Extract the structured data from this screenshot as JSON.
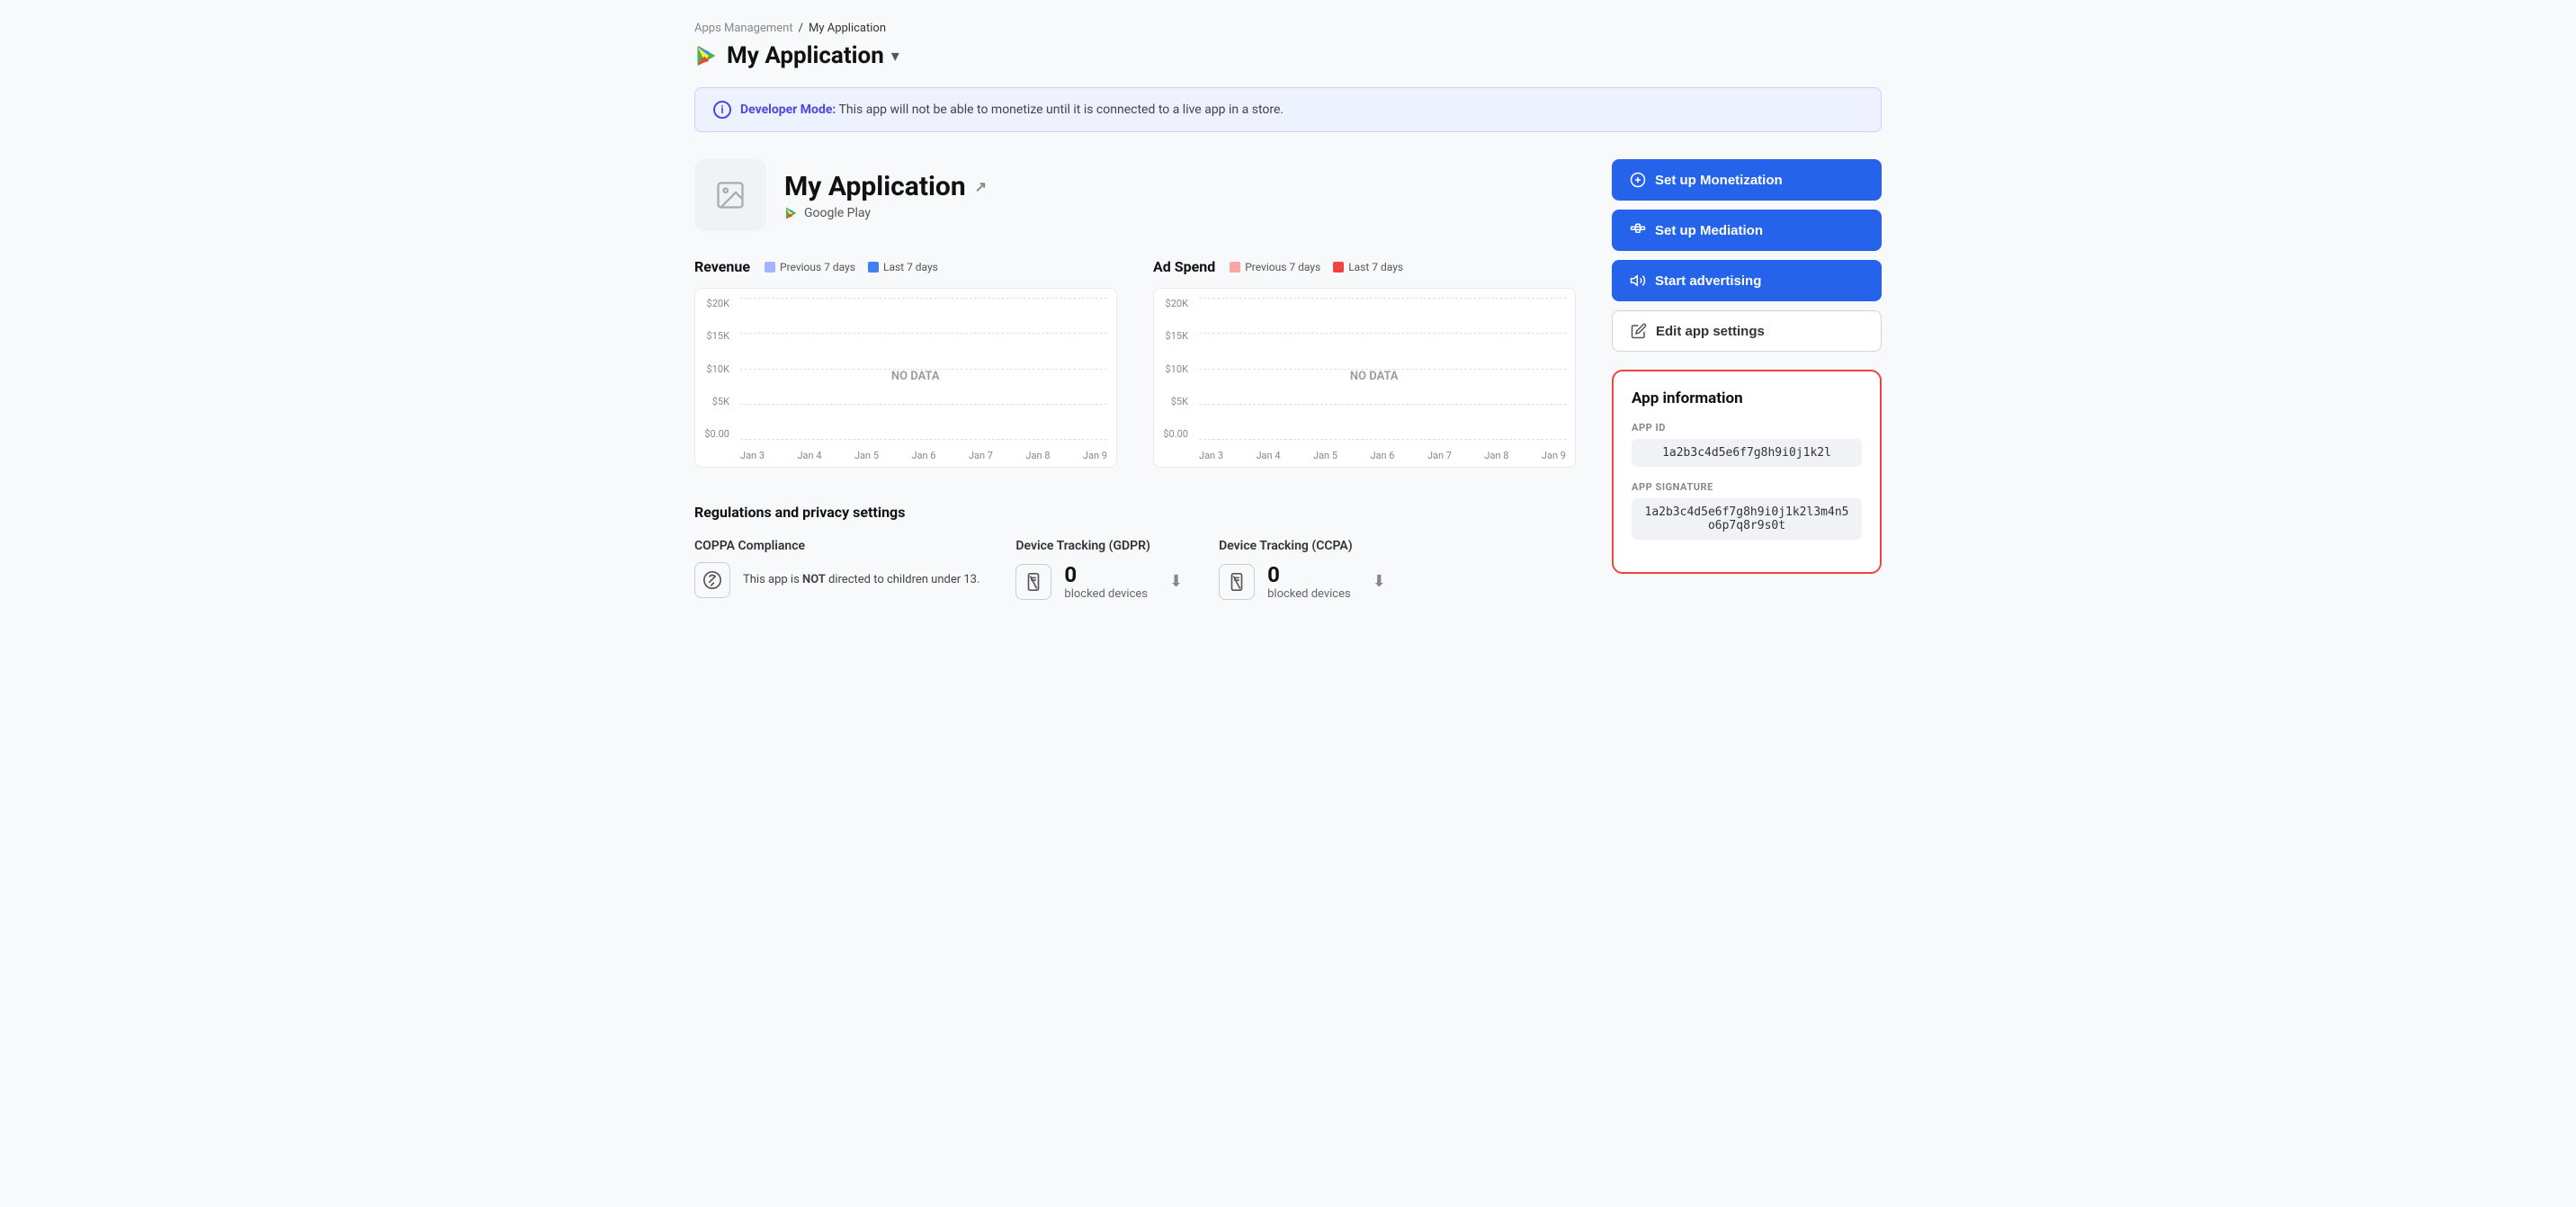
{
  "breadcrumb": {
    "parent": "Apps Management",
    "separator": "/",
    "current": "My Application"
  },
  "header": {
    "app_name": "My Application",
    "chevron": "▾"
  },
  "banner": {
    "label": "Developer Mode:",
    "message": "This app will not be able to monetize until it is connected to a live app in a store."
  },
  "app_card": {
    "title": "My Application",
    "platform": "Google Play",
    "external_link": "↗"
  },
  "charts": {
    "revenue": {
      "title": "Revenue",
      "legend_prev": "Previous 7 days",
      "legend_last": "Last 7 days",
      "prev_color": "#a5b4fc",
      "last_color": "#3b82f6",
      "y_labels": [
        "$20K",
        "$15K",
        "$10K",
        "$5K",
        "$0.00"
      ],
      "x_labels": [
        "Jan 3",
        "Jan 4",
        "Jan 5",
        "Jan 6",
        "Jan 7",
        "Jan 8",
        "Jan 9"
      ],
      "no_data": "NO DATA"
    },
    "ad_spend": {
      "title": "Ad Spend",
      "legend_prev": "Previous 7 days",
      "legend_last": "Last 7 days",
      "prev_color": "#fca5a5",
      "last_color": "#ef4444",
      "y_labels": [
        "$20K",
        "$15K",
        "$10K",
        "$5K",
        "$0.00"
      ],
      "x_labels": [
        "Jan 3",
        "Jan 4",
        "Jan 5",
        "Jan 6",
        "Jan 7",
        "Jan 8",
        "Jan 9"
      ],
      "no_data": "NO DATA"
    }
  },
  "regulations": {
    "section_title": "Regulations and privacy settings",
    "coppa": {
      "title": "COPPA Compliance",
      "description": "This app is ",
      "not_text": "NOT",
      "description2": " directed to children under 13."
    },
    "gdpr": {
      "title": "Device Tracking (GDPR)",
      "count": "0",
      "label": "blocked devices"
    },
    "ccpa": {
      "title": "Device Tracking (CCPA)",
      "count": "0",
      "label": "blocked devices"
    }
  },
  "actions": {
    "monetization": "Set up Monetization",
    "mediation": "Set up Mediation",
    "advertising": "Start advertising",
    "edit_settings": "Edit app settings"
  },
  "app_information": {
    "title": "App information",
    "app_id_label": "APP ID",
    "app_id_value": "1a2b3c4d5e6f7g8h9i0j1k2l",
    "app_sig_label": "APP SIGNATURE",
    "app_sig_value": "1a2b3c4d5e6f7g8h9i0j1k2l3m4n5o6p7q8r9s0t"
  }
}
